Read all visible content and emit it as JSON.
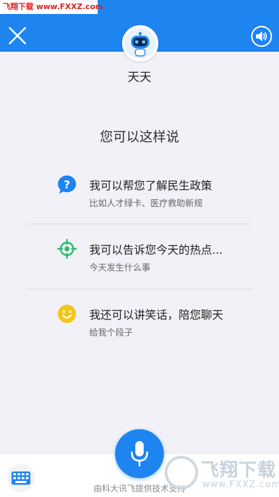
{
  "watermark_top": "飞翔下载 www.FXXZ.com",
  "header": {
    "bot_name": "天天"
  },
  "prompt_title": "您可以这样说",
  "suggestions": [
    {
      "title": "我可以帮您了解民生政策",
      "subtitle": "比如人才绿卡、医疗救助新规",
      "icon": "question-bubble-icon",
      "color": "#1e84f0"
    },
    {
      "title": "我可以告诉您今天的热点...",
      "subtitle": "今天发生什么事",
      "icon": "target-icon",
      "color": "#2dbb6e"
    },
    {
      "title": "我还可以讲笑话，陪您聊天",
      "subtitle": "给我个段子",
      "icon": "smiley-icon",
      "color": "#f5c518"
    }
  ],
  "footer": {
    "powered_by": "由科大讯飞提供技术支持"
  },
  "watermark_logo": {
    "title": "飞翔下载",
    "url": "www.FXXZ.com"
  },
  "colors": {
    "accent": "#1e84f0",
    "background": "#f1f1f7"
  }
}
